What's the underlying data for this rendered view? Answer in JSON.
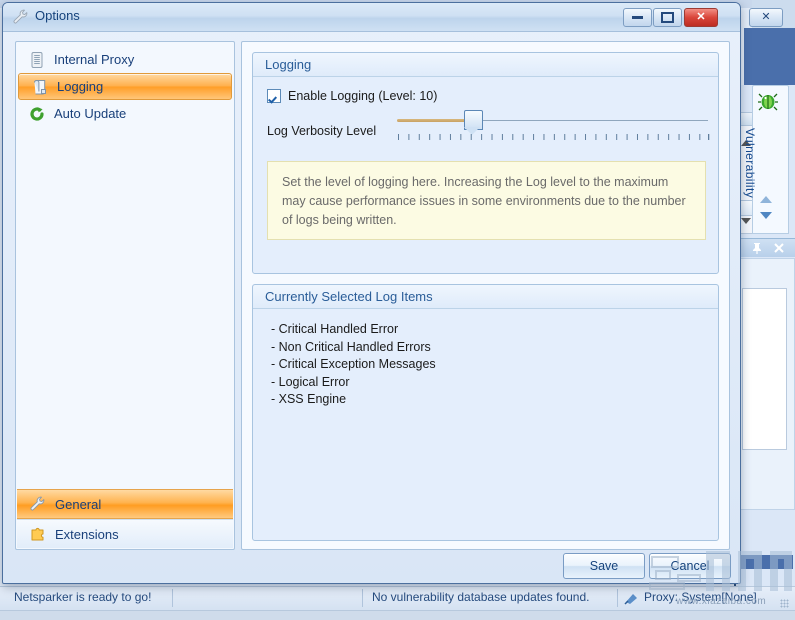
{
  "window": {
    "title": "Options",
    "icon": "wrench-icon",
    "controls": {
      "minimize": "Minimize",
      "maximize": "Maximize",
      "close": "Close"
    }
  },
  "sidebar": {
    "items": [
      {
        "label": "Internal Proxy",
        "icon": "server-icon",
        "selected": false
      },
      {
        "label": "Logging",
        "icon": "scroll-icon",
        "selected": true
      },
      {
        "label": "Auto Update",
        "icon": "refresh-icon",
        "selected": false
      }
    ],
    "categories": [
      {
        "label": "General",
        "icon": "wrench-icon",
        "selected": true
      },
      {
        "label": "Extensions",
        "icon": "puzzle-icon",
        "selected": false
      }
    ]
  },
  "content": {
    "logging_group": {
      "header": "Logging",
      "enable_checkbox": {
        "label": "Enable Logging (Level: 10)",
        "checked": true
      },
      "slider": {
        "label": "Log Verbosity Level",
        "value": 10,
        "min": 1,
        "max": 30,
        "tick_count": 30
      },
      "info": "Set the level of logging here. Increasing the Log level to the maximum may cause performance issues in some environments due to the number of logs being written."
    },
    "selected_items_group": {
      "header": "Currently Selected Log Items",
      "items": [
        "- Critical Handled Error",
        "- Non Critical Handled Errors",
        "- Critical Exception Messages",
        "- Logical Error",
        "- XSS Engine"
      ]
    }
  },
  "buttons": {
    "save": "Save",
    "cancel": "Cancel"
  },
  "right_pane": {
    "vertical_tab": {
      "label": "Vulnerability",
      "icon": "bug-icon"
    },
    "panel_buttons": {
      "pin": "auto-hide",
      "close": "close"
    }
  },
  "statusbar": {
    "message": "Netsparker is ready to go!",
    "updates": "No vulnerability database updates found.",
    "proxy": "Proxy: System[None]",
    "proxy_icon": "proxy-icon"
  },
  "watermark": {
    "url": "www.xiazaiba.com"
  },
  "colors": {
    "accent_orange": "#ff9e28",
    "title_blue": "#16437c",
    "info_yellow": "#fcfbe3",
    "close_red": "#d9453a"
  }
}
